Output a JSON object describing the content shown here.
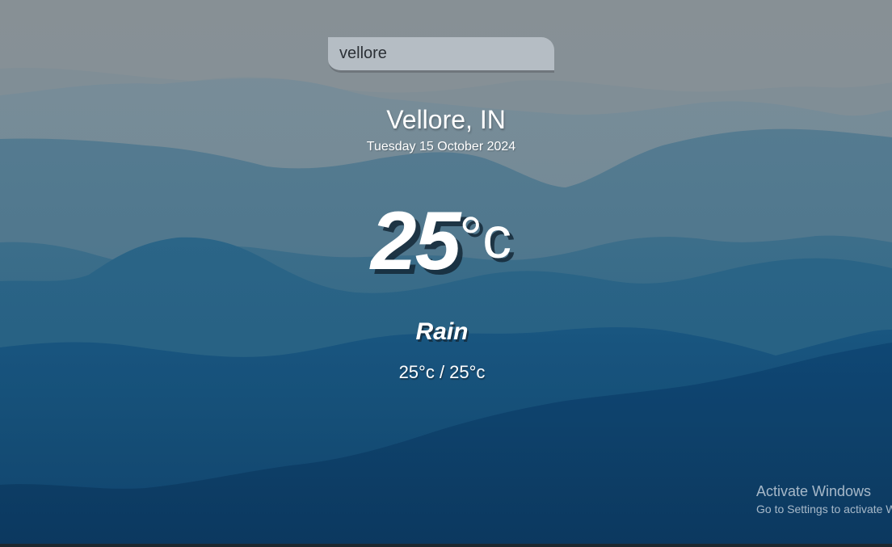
{
  "search": {
    "value": "vellore",
    "placeholder": ""
  },
  "weather": {
    "location": "Vellore, IN",
    "date": "Tuesday 15 October 2024",
    "temperature": "25",
    "unit": "°c",
    "condition": "Rain",
    "hi_lo": "25°c / 25°c"
  },
  "watermark": {
    "title": "Activate Windows",
    "subtitle": "Go to Settings to activate Windows."
  },
  "colors": {
    "sky_top": "#8e989f",
    "mountain_far": "#5d8398",
    "mountain_mid": "#3a7390",
    "mountain_near": "#2a6a90",
    "mountain_front": "#0f3f66"
  },
  "icons": {
    "background": "mountain-landscape"
  }
}
